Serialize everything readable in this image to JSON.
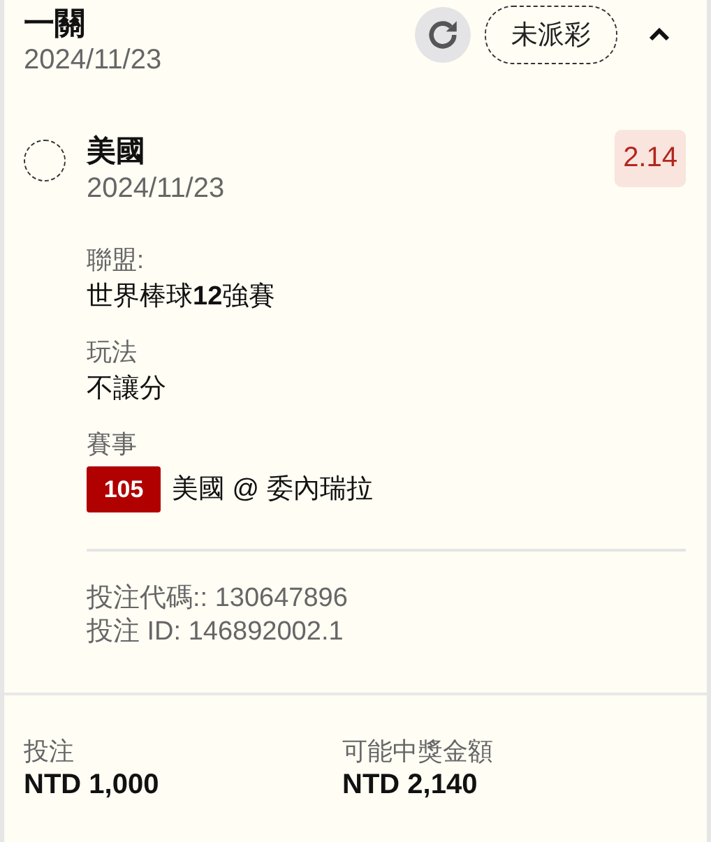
{
  "bet": {
    "title": "一關",
    "date": "2024/11/23",
    "status": "未派彩",
    "expanded": true
  },
  "selection": {
    "name": "美國",
    "date": "2024/11/23",
    "odds": "2.14",
    "details": [
      {
        "label": "聯盟:",
        "value": "世界棒球**12**強賽"
      },
      {
        "label": "玩法",
        "value": "不讓分"
      }
    ],
    "event": {
      "label": "賽事",
      "number": "105",
      "match": "美國 @ 委內瑞拉"
    }
  },
  "codes": [
    "投注代碼:: 130647896",
    "投注 ID: 146892002.1"
  ],
  "summary": [
    {
      "label": "投注",
      "value": "NTD 1,000"
    },
    {
      "label": "可能中獎金額",
      "value": "NTD 2,140"
    }
  ]
}
